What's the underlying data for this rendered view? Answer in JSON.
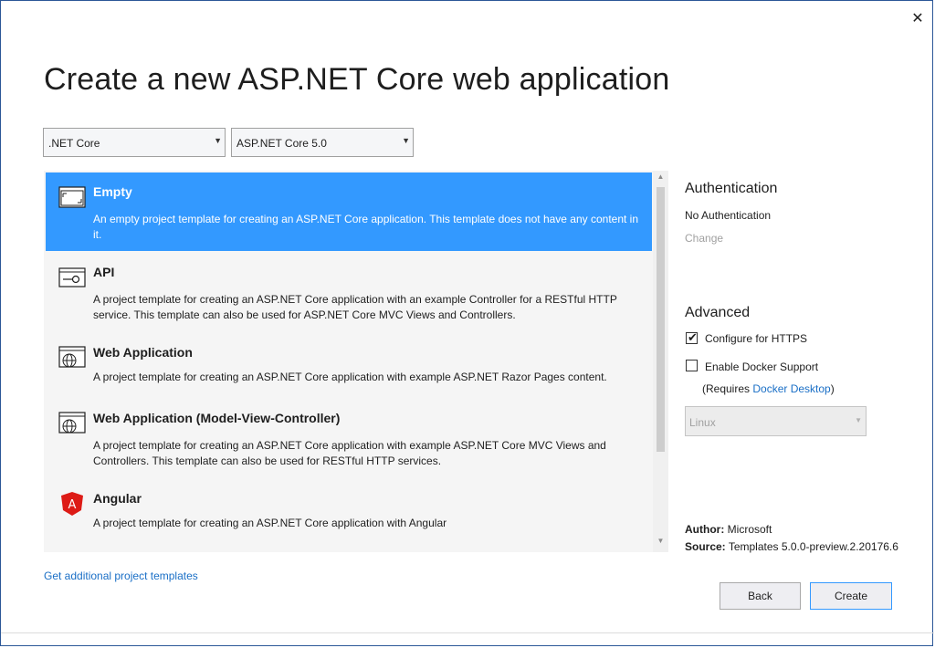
{
  "window": {
    "title": "Create a new ASP.NET Core web application",
    "close_glyph": "✕"
  },
  "filters": {
    "framework": {
      "value": ".NET Core"
    },
    "version": {
      "value": "ASP.NET Core 5.0"
    }
  },
  "templates": [
    {
      "name": "Empty",
      "description": "An empty project template for creating an ASP.NET Core application. This template does not have any content in it.",
      "icon": "empty-template-icon",
      "selected": true
    },
    {
      "name": "API",
      "description": "A project template for creating an ASP.NET Core application with an example Controller for a RESTful HTTP service. This template can also be used for ASP.NET Core MVC Views and Controllers.",
      "icon": "api-template-icon",
      "selected": false
    },
    {
      "name": "Web Application",
      "description": "A project template for creating an ASP.NET Core application with example ASP.NET Razor Pages content.",
      "icon": "globe-template-icon",
      "selected": false
    },
    {
      "name": "Web Application (Model-View-Controller)",
      "description": "A project template for creating an ASP.NET Core application with example ASP.NET Core MVC Views and Controllers. This template can also be used for RESTful HTTP services.",
      "icon": "globe-template-icon",
      "selected": false
    },
    {
      "name": "Angular",
      "description": "A project template for creating an ASP.NET Core application with Angular",
      "icon": "angular-icon",
      "selected": false
    }
  ],
  "authentication": {
    "heading": "Authentication",
    "value": "No Authentication",
    "change_label": "Change"
  },
  "advanced": {
    "heading": "Advanced",
    "https": {
      "label": "Configure for HTTPS",
      "checked": true
    },
    "docker": {
      "label": "Enable Docker Support",
      "checked": false
    },
    "requires_prefix": "(Requires ",
    "requires_link": "Docker Desktop",
    "requires_suffix": ")",
    "os_value": "Linux"
  },
  "info": {
    "author_label": "Author:",
    "author_value": "Microsoft",
    "source_label": "Source:",
    "source_value": "Templates 5.0.0-preview.2.20176.6"
  },
  "footer": {
    "more_templates_link": "Get additional project templates",
    "back_label": "Back",
    "create_label": "Create"
  },
  "colors": {
    "accent": "#3399ff",
    "link": "#1a6fc6",
    "border": "#2b5797"
  }
}
